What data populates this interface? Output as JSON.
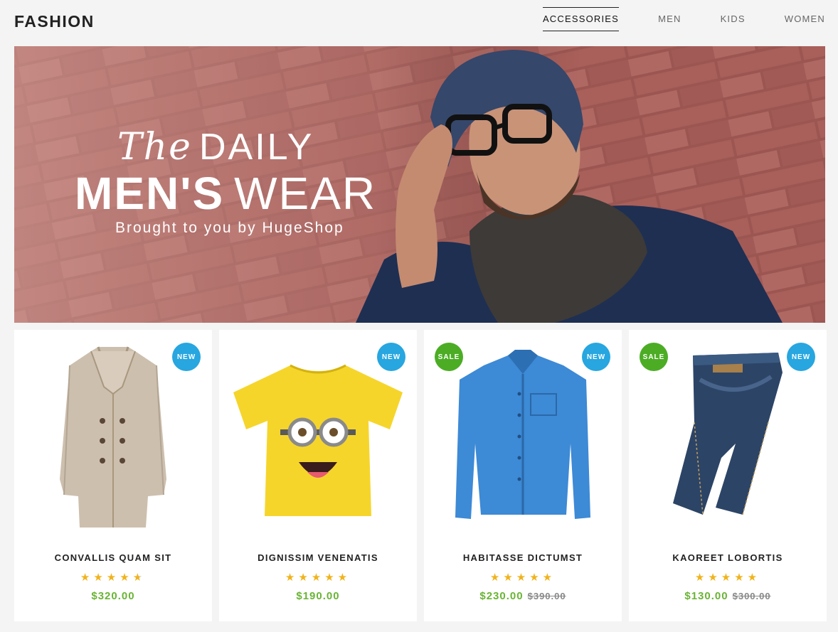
{
  "header": {
    "logo": "FASHION",
    "nav": [
      {
        "label": "ACCESSORIES",
        "active": true
      },
      {
        "label": "MEN",
        "active": false
      },
      {
        "label": "KIDS",
        "active": false
      },
      {
        "label": "WOMEN",
        "active": false
      }
    ]
  },
  "hero": {
    "line1_script": "The",
    "line1_caps": "DAILY",
    "line2_bold": "MEN'S",
    "line2_light": "WEAR",
    "subtitle": "Brought to you by HugeShop"
  },
  "products": [
    {
      "name": "CONVALLIS QUAM SIT",
      "rating": 4.5,
      "stars": "★★★★★",
      "price": "$320.00",
      "old_price": "",
      "badges": {
        "new": "NEW",
        "sale": ""
      },
      "image_icon": "beige-coat-icon"
    },
    {
      "name": "DIGNISSIM VENENATIS",
      "rating": 5,
      "stars": "★★★★★",
      "price": "$190.00",
      "old_price": "",
      "badges": {
        "new": "NEW",
        "sale": ""
      },
      "image_icon": "yellow-tshirt-icon"
    },
    {
      "name": "HABITASSE DICTUMST",
      "rating": 5,
      "stars": "★★★★★",
      "price": "$230.00",
      "old_price": "$390.00",
      "badges": {
        "new": "NEW",
        "sale": "SALE"
      },
      "image_icon": "blue-shirt-icon"
    },
    {
      "name": "KAOREET LOBORTIS",
      "rating": 5,
      "stars": "★★★★★",
      "price": "$130.00",
      "old_price": "$300.00",
      "badges": {
        "new": "NEW",
        "sale": "SALE"
      },
      "image_icon": "denim-jeans-icon"
    }
  ],
  "colors": {
    "new_badge": "#27a6e0",
    "sale_badge": "#4cad25",
    "price": "#6ab435",
    "star": "#f0b31c"
  }
}
